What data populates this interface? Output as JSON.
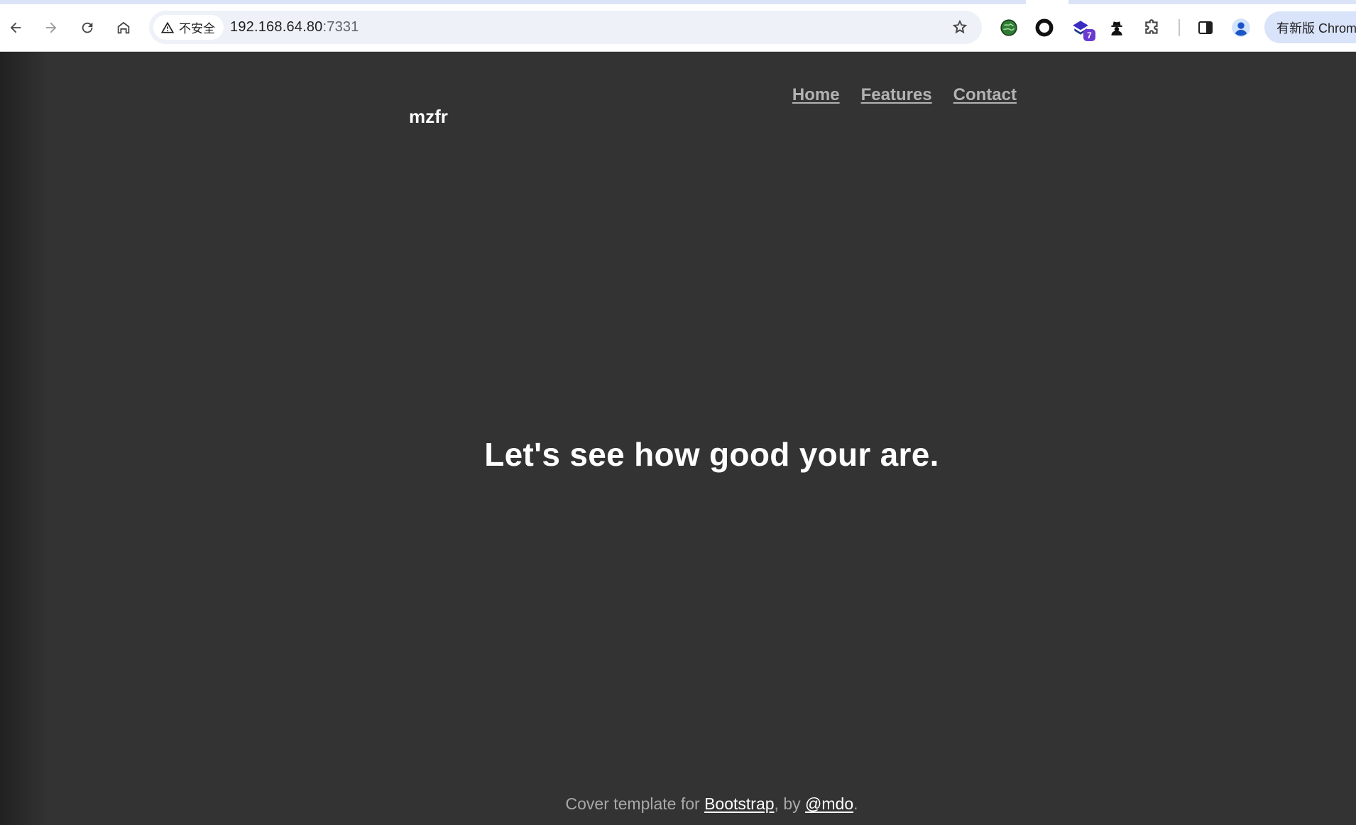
{
  "browser": {
    "security_label": "不安全",
    "url_host": "192.168.64.80",
    "url_port": ":7331",
    "extension_badge": "7",
    "update_button": "有新版 Chrom"
  },
  "site": {
    "brand": "mzfr",
    "nav": [
      "Home",
      "Features",
      "Contact"
    ],
    "hero_heading": "Let's see how good your are.",
    "footer": {
      "prefix": "Cover template for ",
      "link1": "Bootstrap",
      "middle": ", by ",
      "link2": "@mdo",
      "suffix": "."
    }
  }
}
